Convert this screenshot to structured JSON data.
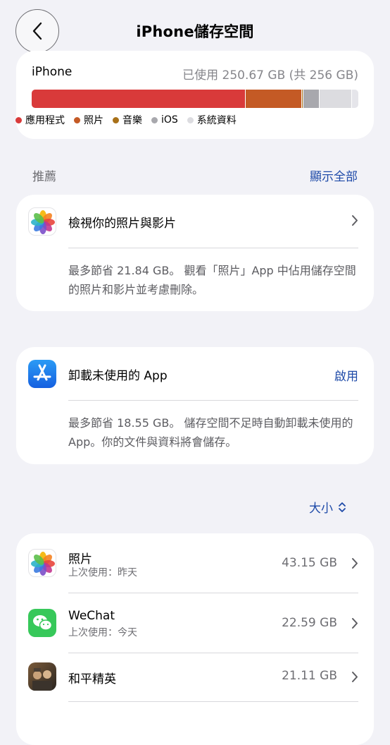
{
  "nav": {
    "title": "iPhone儲存空間"
  },
  "storage": {
    "device": "iPhone",
    "used_text": "已使用 250.67 GB (共 256 GB)",
    "segments": [
      {
        "label": "應用程式",
        "color": "#d93a3a",
        "fraction": 0.656
      },
      {
        "label": "照片",
        "color": "#c45a25",
        "fraction": 0.172
      },
      {
        "label": "音樂",
        "color": "#a87018",
        "fraction": 0.005
      },
      {
        "label": "iOS",
        "color": "#a8a8ad",
        "fraction": 0.048
      },
      {
        "label": "系統資料",
        "color": "#dcdce0",
        "fraction": 0.099
      }
    ]
  },
  "recommendations": {
    "label": "推薦",
    "show_all": "顯示全部",
    "items": [
      {
        "title": "檢視你的照片與影片",
        "desc": "最多節省 21.84 GB。 觀看「照片」App 中佔用儲存空間的照片和影片並考慮刪除。",
        "icon": "photos-icon"
      },
      {
        "title": "卸載未使用的 App",
        "action": "啟用",
        "desc": "最多節省 18.55 GB。 儲存空間不足時自動卸載未使用的 App。你的文件與資料將會儲存。",
        "icon": "app-store-icon"
      }
    ]
  },
  "sort": {
    "label": "大小"
  },
  "apps": [
    {
      "name": "照片",
      "last_used": "上次使用：昨天",
      "size": "43.15 GB",
      "icon": "photos-icon"
    },
    {
      "name": "WeChat",
      "last_used": "上次使用：今天",
      "size": "22.59 GB",
      "icon": "wechat-icon"
    },
    {
      "name": "和平精英",
      "last_used": "",
      "size": "21.11 GB",
      "icon": "game-icon"
    }
  ],
  "colors": {
    "accent": "#1e4aa8",
    "background": "#f2f2f7"
  }
}
